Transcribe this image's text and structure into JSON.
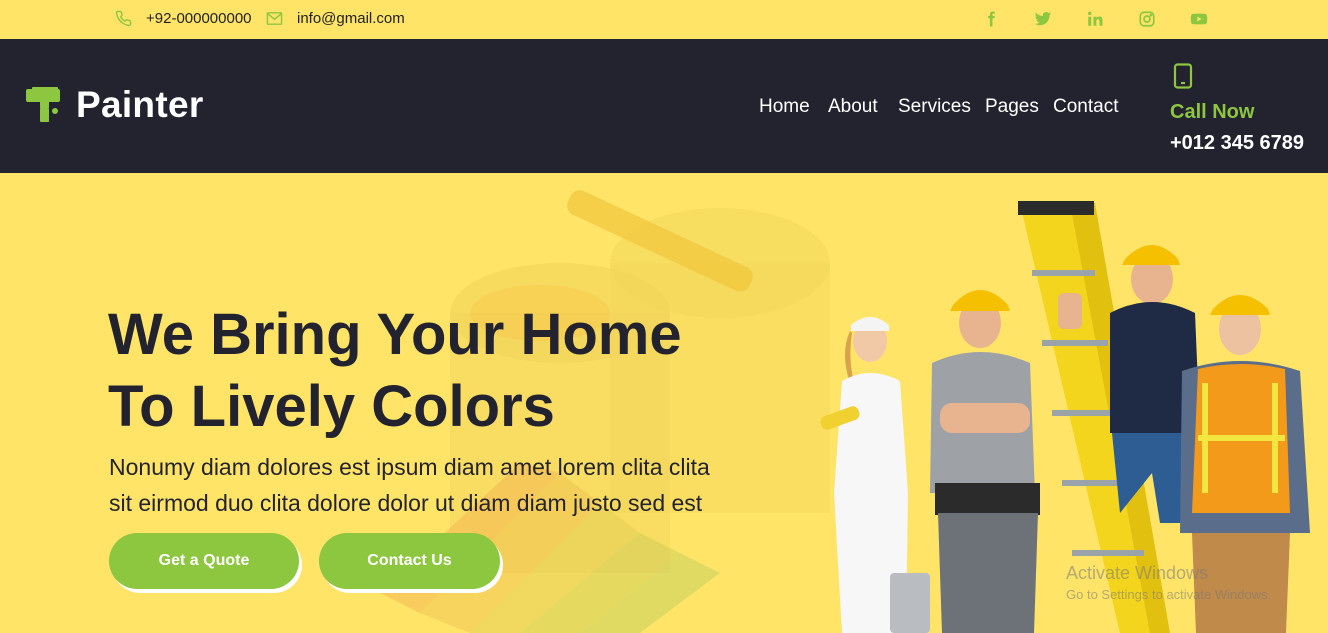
{
  "topbar": {
    "phone": "+92-000000000",
    "email": "info@gmail.com",
    "social_icons": [
      "facebook-icon",
      "twitter-icon",
      "linkedin-icon",
      "instagram-icon",
      "youtube-icon"
    ]
  },
  "navbar": {
    "brand": "Painter",
    "links": [
      "Home",
      "About",
      "Services",
      "Pages",
      "Contact"
    ],
    "call_label": "Call Now",
    "call_number": "+012 345 6789"
  },
  "hero": {
    "title_line1": "We Bring Your Home",
    "title_line2": "To Lively Colors",
    "text_line1": "Nonumy diam dolores est ipsum diam amet lorem clita clita",
    "text_line2": "sit eirmod duo clita dolore dolor ut diam diam justo sed est",
    "button_quote": "Get a Quote",
    "button_contact": "Contact Us"
  },
  "watermark": {
    "line1": "Activate Windows",
    "line2": "Go to Settings to activate Windows."
  },
  "colors": {
    "accent": "#8DC63F",
    "dark": "#23232F",
    "yellow": "#FFE468"
  }
}
